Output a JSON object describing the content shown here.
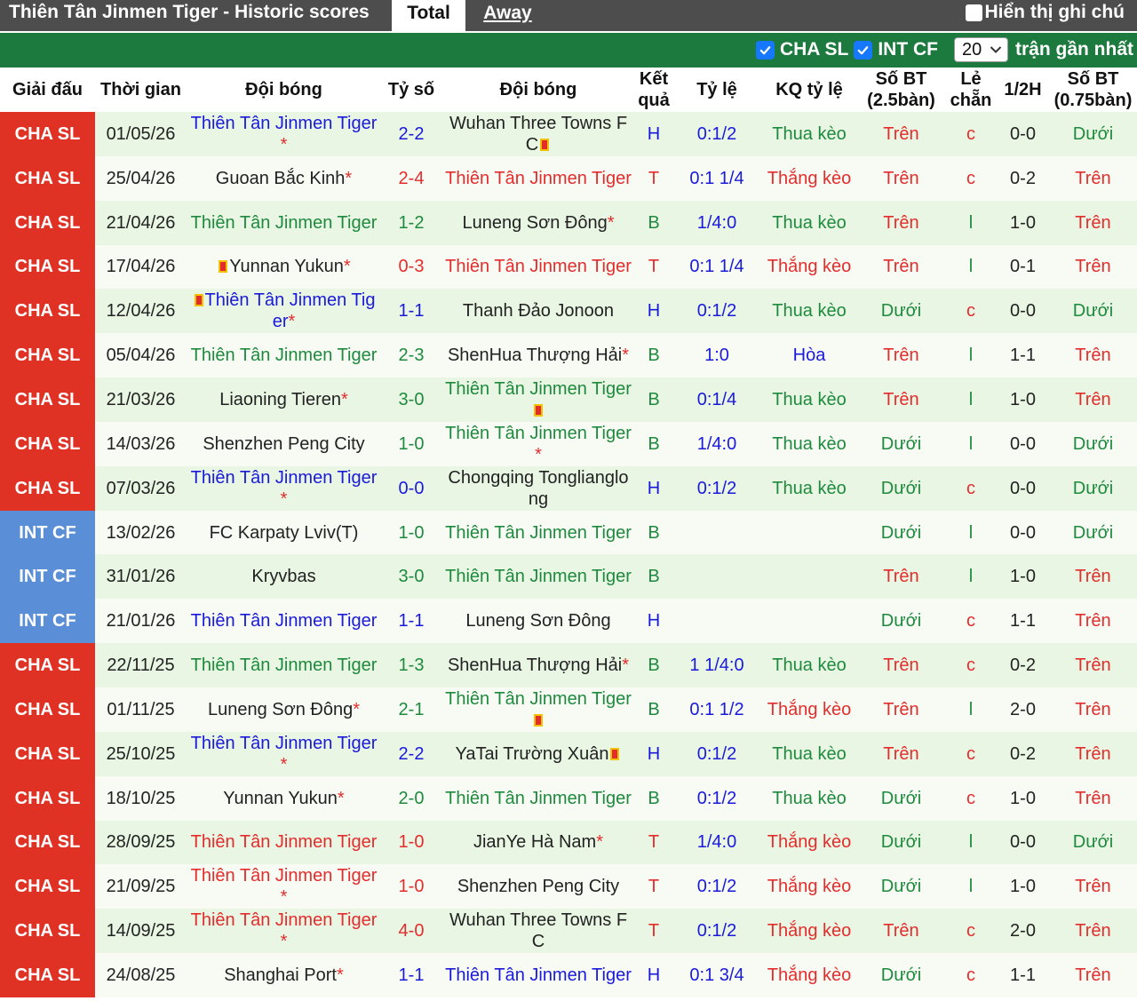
{
  "header": {
    "title": "Thiên Tân Jinmen Tiger - Historic scores",
    "tabs": [
      {
        "label": "Total",
        "active": true
      },
      {
        "label": "Away",
        "active": false
      }
    ],
    "show_notes_label": "Hiển thị ghi chú"
  },
  "filters": {
    "leagues": [
      {
        "label": "CHA SL",
        "checked": true
      },
      {
        "label": "INT CF",
        "checked": true
      }
    ],
    "count_value": "20",
    "count_suffix": "trận gần nhất"
  },
  "colors": {
    "cha_sl": "#e03224",
    "int_cf": "#5a8ed6",
    "header_bar": "#4d4d4d",
    "filter_bar": "#1c7a3e"
  },
  "columns": [
    "Giải đấu",
    "Thời gian",
    "Đội bóng",
    "Tỷ số",
    "Đội bóng",
    "Kết quả",
    "Tỷ lệ",
    "KQ tỷ lệ",
    "Số BT (2.5bàn)",
    "Lẻ chẵn",
    "1/2H",
    "Số BT (0.75bàn)"
  ],
  "rows": [
    {
      "league": "CHA SL",
      "date": "01/05/26",
      "home": "Thiên Tân Jinmen Tiger",
      "home_mark": "*",
      "home_card": false,
      "home_color": "blue",
      "score": "2-2",
      "away": "Wuhan Three Towns FC",
      "away_mark": "",
      "away_card": true,
      "away_color": "black",
      "result": "H",
      "odds": "0:1/2",
      "odds_result": "Thua kèo",
      "ou": "Trên",
      "oe": "c",
      "half": "0-0",
      "ou2": "Dưới"
    },
    {
      "league": "CHA SL",
      "date": "25/04/26",
      "home": "Guoan Bắc Kinh",
      "home_mark": "*",
      "home_card": false,
      "home_color": "black",
      "score": "2-4",
      "away": "Thiên Tân Jinmen Tiger",
      "away_mark": "",
      "away_card": false,
      "away_color": "red",
      "result": "T",
      "odds": "0:1 1/4",
      "odds_result": "Thắng kèo",
      "ou": "Trên",
      "oe": "c",
      "half": "0-2",
      "ou2": "Trên"
    },
    {
      "league": "CHA SL",
      "date": "21/04/26",
      "home": "Thiên Tân Jinmen Tiger",
      "home_mark": "",
      "home_card": false,
      "home_color": "green",
      "score": "1-2",
      "away": "Luneng Sơn Đông",
      "away_mark": "*",
      "away_card": false,
      "away_color": "black",
      "result": "B",
      "odds": "1/4:0",
      "odds_result": "Thua kèo",
      "ou": "Trên",
      "oe": "l",
      "half": "1-0",
      "ou2": "Trên"
    },
    {
      "league": "CHA SL",
      "date": "17/04/26",
      "home": "Yunnan Yukun",
      "home_mark": "*",
      "home_card": true,
      "home_color": "black",
      "score": "0-3",
      "away": "Thiên Tân Jinmen Tiger",
      "away_mark": "",
      "away_card": false,
      "away_color": "red",
      "result": "T",
      "odds": "0:1 1/4",
      "odds_result": "Thắng kèo",
      "ou": "Trên",
      "oe": "l",
      "half": "0-1",
      "ou2": "Trên"
    },
    {
      "league": "CHA SL",
      "date": "12/04/26",
      "home": "Thiên Tân Jinmen Tiger",
      "home_mark": "*",
      "home_card": true,
      "home_color": "blue",
      "score": "1-1",
      "away": "Thanh Đảo Jonoon",
      "away_mark": "",
      "away_card": false,
      "away_color": "black",
      "result": "H",
      "odds": "0:1/2",
      "odds_result": "Thua kèo",
      "ou": "Dưới",
      "oe": "c",
      "half": "0-0",
      "ou2": "Dưới"
    },
    {
      "league": "CHA SL",
      "date": "05/04/26",
      "home": "Thiên Tân Jinmen Tiger",
      "home_mark": "",
      "home_card": false,
      "home_color": "green",
      "score": "2-3",
      "away": "ShenHua Thượng Hải",
      "away_mark": "*",
      "away_card": false,
      "away_color": "black",
      "result": "B",
      "odds": "1:0",
      "odds_result": "Hòa",
      "ou": "Trên",
      "oe": "l",
      "half": "1-1",
      "ou2": "Trên"
    },
    {
      "league": "CHA SL",
      "date": "21/03/26",
      "home": "Liaoning Tieren",
      "home_mark": "*",
      "home_card": false,
      "home_color": "black",
      "score": "3-0",
      "away": "Thiên Tân Jinmen Tiger",
      "away_mark": "",
      "away_card": true,
      "away_color": "green",
      "result": "B",
      "odds": "0:1/4",
      "odds_result": "Thua kèo",
      "ou": "Trên",
      "oe": "l",
      "half": "1-0",
      "ou2": "Trên"
    },
    {
      "league": "CHA SL",
      "date": "14/03/26",
      "home": "Shenzhen Peng City",
      "home_mark": "",
      "home_card": false,
      "home_color": "black",
      "score": "1-0",
      "away": "Thiên Tân Jinmen Tiger",
      "away_mark": "*",
      "away_card": false,
      "away_color": "green",
      "result": "B",
      "odds": "1/4:0",
      "odds_result": "Thua kèo",
      "ou": "Dưới",
      "oe": "l",
      "half": "0-0",
      "ou2": "Dưới"
    },
    {
      "league": "CHA SL",
      "date": "07/03/26",
      "home": "Thiên Tân Jinmen Tiger",
      "home_mark": "*",
      "home_card": false,
      "home_color": "blue",
      "score": "0-0",
      "away": "Chongqing Tonglianglong",
      "away_mark": "",
      "away_card": false,
      "away_color": "black",
      "result": "H",
      "odds": "0:1/2",
      "odds_result": "Thua kèo",
      "ou": "Dưới",
      "oe": "c",
      "half": "0-0",
      "ou2": "Dưới"
    },
    {
      "league": "INT CF",
      "date": "13/02/26",
      "home": "FC Karpaty Lviv(T)",
      "home_mark": "",
      "home_card": false,
      "home_color": "black",
      "score": "1-0",
      "away": "Thiên Tân Jinmen Tiger",
      "away_mark": "",
      "away_card": false,
      "away_color": "green",
      "result": "B",
      "odds": "",
      "odds_result": "",
      "ou": "Dưới",
      "oe": "l",
      "half": "0-0",
      "ou2": "Dưới"
    },
    {
      "league": "INT CF",
      "date": "31/01/26",
      "home": "Kryvbas",
      "home_mark": "",
      "home_card": false,
      "home_color": "black",
      "score": "3-0",
      "away": "Thiên Tân Jinmen Tiger",
      "away_mark": "",
      "away_card": false,
      "away_color": "green",
      "result": "B",
      "odds": "",
      "odds_result": "",
      "ou": "Trên",
      "oe": "l",
      "half": "1-0",
      "ou2": "Trên"
    },
    {
      "league": "INT CF",
      "date": "21/01/26",
      "home": "Thiên Tân Jinmen Tiger",
      "home_mark": "",
      "home_card": false,
      "home_color": "blue",
      "score": "1-1",
      "away": "Luneng Sơn Đông",
      "away_mark": "",
      "away_card": false,
      "away_color": "black",
      "result": "H",
      "odds": "",
      "odds_result": "",
      "ou": "Dưới",
      "oe": "c",
      "half": "1-1",
      "ou2": "Trên"
    },
    {
      "league": "CHA SL",
      "date": "22/11/25",
      "home": "Thiên Tân Jinmen Tiger",
      "home_mark": "",
      "home_card": false,
      "home_color": "green",
      "score": "1-3",
      "away": "ShenHua Thượng Hải",
      "away_mark": "*",
      "away_card": false,
      "away_color": "black",
      "result": "B",
      "odds": "1 1/4:0",
      "odds_result": "Thua kèo",
      "ou": "Trên",
      "oe": "c",
      "half": "0-2",
      "ou2": "Trên"
    },
    {
      "league": "CHA SL",
      "date": "01/11/25",
      "home": "Luneng Sơn Đông",
      "home_mark": "*",
      "home_card": false,
      "home_color": "black",
      "score": "2-1",
      "away": "Thiên Tân Jinmen Tiger",
      "away_mark": "",
      "away_card": true,
      "away_color": "green",
      "result": "B",
      "odds": "0:1 1/2",
      "odds_result": "Thắng kèo",
      "ou": "Trên",
      "oe": "l",
      "half": "2-0",
      "ou2": "Trên"
    },
    {
      "league": "CHA SL",
      "date": "25/10/25",
      "home": "Thiên Tân Jinmen Tiger",
      "home_mark": "*",
      "home_card": false,
      "home_color": "blue",
      "score": "2-2",
      "away": "YaTai Trường Xuân",
      "away_mark": "",
      "away_card": true,
      "away_color": "black",
      "result": "H",
      "odds": "0:1/2",
      "odds_result": "Thua kèo",
      "ou": "Trên",
      "oe": "c",
      "half": "0-2",
      "ou2": "Trên"
    },
    {
      "league": "CHA SL",
      "date": "18/10/25",
      "home": "Yunnan Yukun",
      "home_mark": "*",
      "home_card": false,
      "home_color": "black",
      "score": "2-0",
      "away": "Thiên Tân Jinmen Tiger",
      "away_mark": "",
      "away_card": false,
      "away_color": "green",
      "result": "B",
      "odds": "0:1/2",
      "odds_result": "Thua kèo",
      "ou": "Dưới",
      "oe": "c",
      "half": "1-0",
      "ou2": "Trên"
    },
    {
      "league": "CHA SL",
      "date": "28/09/25",
      "home": "Thiên Tân Jinmen Tiger",
      "home_mark": "",
      "home_card": false,
      "home_color": "red",
      "score": "1-0",
      "away": "JianYe Hà Nam",
      "away_mark": "*",
      "away_card": false,
      "away_color": "black",
      "result": "T",
      "odds": "1/4:0",
      "odds_result": "Thắng kèo",
      "ou": "Dưới",
      "oe": "l",
      "half": "0-0",
      "ou2": "Dưới"
    },
    {
      "league": "CHA SL",
      "date": "21/09/25",
      "home": "Thiên Tân Jinmen Tiger",
      "home_mark": "*",
      "home_card": false,
      "home_color": "red",
      "score": "1-0",
      "away": "Shenzhen Peng City",
      "away_mark": "",
      "away_card": false,
      "away_color": "black",
      "result": "T",
      "odds": "0:1/2",
      "odds_result": "Thắng kèo",
      "ou": "Dưới",
      "oe": "l",
      "half": "1-0",
      "ou2": "Trên"
    },
    {
      "league": "CHA SL",
      "date": "14/09/25",
      "home": "Thiên Tân Jinmen Tiger",
      "home_mark": "*",
      "home_card": false,
      "home_color": "red",
      "score": "4-0",
      "away": "Wuhan Three Towns FC",
      "away_mark": "",
      "away_card": false,
      "away_color": "black",
      "result": "T",
      "odds": "0:1/2",
      "odds_result": "Thắng kèo",
      "ou": "Trên",
      "oe": "c",
      "half": "2-0",
      "ou2": "Trên"
    },
    {
      "league": "CHA SL",
      "date": "24/08/25",
      "home": "Shanghai Port",
      "home_mark": "*",
      "home_card": false,
      "home_color": "black",
      "score": "1-1",
      "away": "Thiên Tân Jinmen Tiger",
      "away_mark": "",
      "away_card": false,
      "away_color": "blue",
      "result": "H",
      "odds": "0:1 3/4",
      "odds_result": "Thắng kèo",
      "ou": "Dưới",
      "oe": "c",
      "half": "1-1",
      "ou2": "Trên"
    }
  ]
}
